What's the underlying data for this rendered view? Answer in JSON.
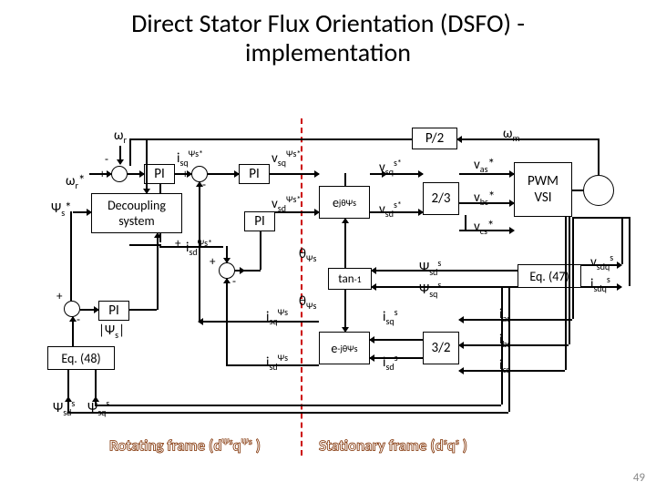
{
  "title_line1": "Direct Stator Flux Orientation (DSFO) -",
  "title_line2": "implementation",
  "labels": {
    "wr": "ωr",
    "wm": "ωm",
    "wr_star": "ωr*",
    "psi_s_star": "Ψs*",
    "psi_s_mag": "|Ψs|",
    "eq48": "Eq. (48)",
    "eq47": "Eq. (47)",
    "psi_sd_s": "Ψsds",
    "psi_sq_s": "Ψsqs",
    "psi_sd_s2": "Ψsds",
    "psi_sq_s2": "Ψsqs",
    "isq_psis_star": "isqΨs*",
    "isd_psis_star": "isdΨs*",
    "vsq_psis_star": "vsqΨs*",
    "vsd_psis_star": "vsdΨs*",
    "vsq_s_star": "vsqs*",
    "vsd_s_star": "vsds*",
    "vas_star": "vas*",
    "vbs_star": "vbs*",
    "vcs_star": "vcs*",
    "theta_psis_top": "θΨs",
    "theta_psis_bot": "θΨs",
    "isq_psis": "isqΨs",
    "isd_psis": "isdΨs",
    "isq_s": "isqs",
    "isd_s": "isds",
    "ias": "ias",
    "ibs": "ibs",
    "ics": "ics",
    "vsdq_s": "vsdqs",
    "isdq_s": "isdqs"
  },
  "blocks": {
    "pi": "PI",
    "decoupling": "Decoupling\nsystem",
    "p2": "P/2",
    "ejtheta": "ejθΨs",
    "emjtheta": "e-jθΨs",
    "two3": "2/3",
    "three2": "3/2",
    "atan": "tan-1",
    "pwm": "PWM\nVSI"
  },
  "footer": {
    "rot": "Rotating frame (dΨsqΨs )",
    "stat": "Stationary frame (dsqs )"
  },
  "slide_no": "49"
}
